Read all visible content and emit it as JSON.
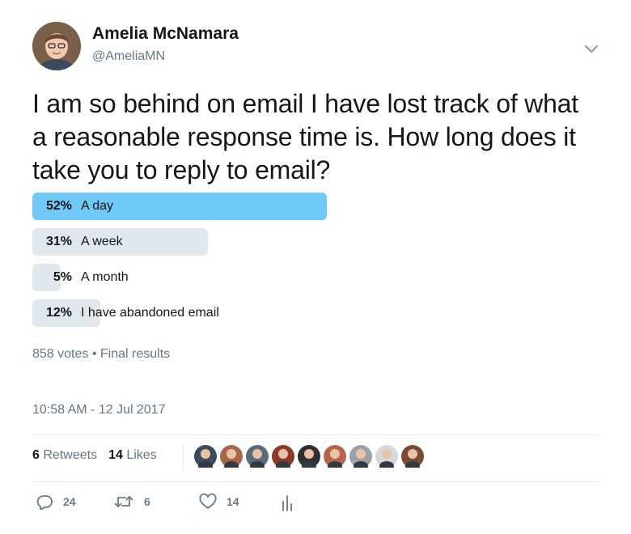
{
  "author": {
    "name": "Amelia McNamara",
    "handle": "@AmeliaMN"
  },
  "tweet": {
    "text": "I am so behind on email I have lost track of what a reasonable response time is. How long does it take you to reply to email?"
  },
  "poll": {
    "options": [
      {
        "percent_label": "52%",
        "label": "A day",
        "value": 52,
        "winner": true
      },
      {
        "percent_label": "31%",
        "label": "A week",
        "value": 31,
        "winner": false
      },
      {
        "percent_label": "5%",
        "label": "A month",
        "value": 5,
        "winner": false
      },
      {
        "percent_label": "12%",
        "label": "I have abandoned email",
        "value": 12,
        "winner": false
      }
    ],
    "votes": "858 votes",
    "separator": "•",
    "status": "Final results"
  },
  "timestamp": "10:58 AM - 12 Jul 2017",
  "stats": {
    "retweets_count": "6",
    "retweets_label": "Retweets",
    "likes_count": "14",
    "likes_label": "Likes"
  },
  "likers_count": 9,
  "actions": {
    "reply_count": "24",
    "retweet_count": "6",
    "like_count": "14"
  },
  "colors": {
    "winner_bar": "#71c9f8",
    "bar": "#e1e8ed",
    "secondary_text": "#657786"
  }
}
